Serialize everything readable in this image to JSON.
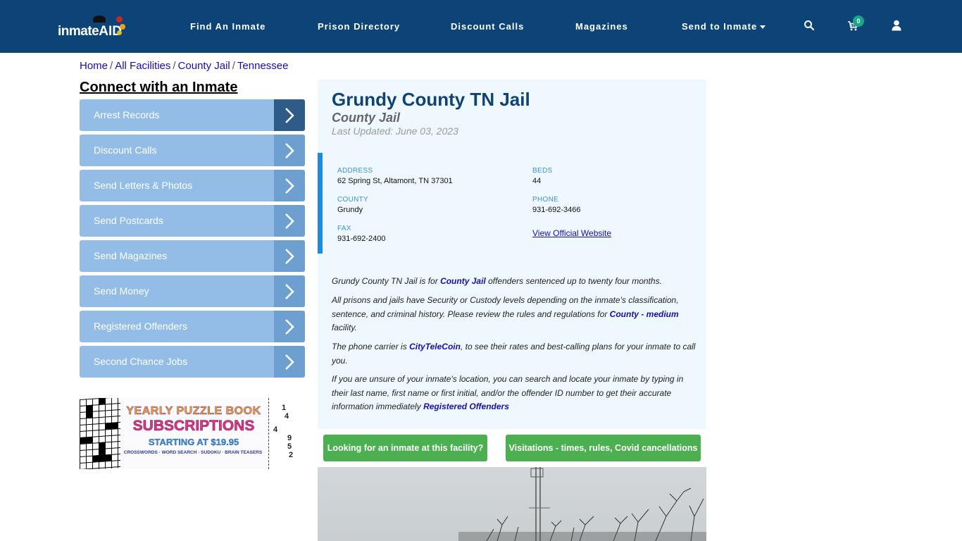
{
  "brand": {
    "logo_text_main": "inmate",
    "logo_text_accent": "AID"
  },
  "nav": {
    "links": [
      {
        "label": "Find An Inmate"
      },
      {
        "label": "Prison Directory"
      },
      {
        "label": "Discount Calls"
      },
      {
        "label": "Magazines"
      },
      {
        "label": "Send to Inmate"
      }
    ],
    "cart_count": "0",
    "icons": [
      "search-icon",
      "cart-icon",
      "user-icon"
    ]
  },
  "breadcrumb": [
    {
      "label": "Home"
    },
    {
      "label": "All Facilities"
    },
    {
      "label": "County Jail"
    },
    {
      "label": "Tennessee"
    }
  ],
  "breadcrumb_separator": "/",
  "sidebar": {
    "title": "Connect with an Inmate",
    "items": [
      {
        "label": "Arrest Records"
      },
      {
        "label": "Discount Calls"
      },
      {
        "label": "Send Letters & Photos"
      },
      {
        "label": "Send Postcards"
      },
      {
        "label": "Send Magazines"
      },
      {
        "label": "Send Money"
      },
      {
        "label": "Registered Offenders"
      },
      {
        "label": "Second Chance Jobs"
      }
    ],
    "ad": {
      "line1": "YEARLY PUZZLE BOOK",
      "line2": "SUBSCRIPTIONS",
      "line3": "STARTING AT $19.95",
      "line4": "CROSSWORDS · WORD SEARCH · SUDOKU · BRAIN TEASERS",
      "sudoku_numbers": [
        "1",
        "4",
        "4",
        "9",
        "5",
        "2"
      ]
    }
  },
  "facility": {
    "title": "Grundy County TN Jail",
    "type": "County Jail",
    "last_updated": "Last Updated: June 03, 2023",
    "fields": {
      "address_label": "ADDRESS",
      "address": "62 Spring St, Altamont, TN 37301",
      "beds_label": "BEDS",
      "beds": "44",
      "county_label": "COUNTY",
      "county": "Grundy",
      "phone_label": "PHONE",
      "phone": "931-692-3466",
      "fax_label": "FAX",
      "fax": "931-692-2400",
      "website_link": "View Official Website"
    },
    "description": {
      "p1_a": "Grundy County TN Jail is for ",
      "p1_link": "County Jail",
      "p1_b": " offenders sentenced up to twenty four months.",
      "p2_a": "All prisons and jails have Security or Custody levels depending on the inmate's classification, sentence, and criminal history. Please review the rules and regulations for ",
      "p2_link": "County - medium",
      "p2_b": " facility.",
      "p3_a": "The phone carrier is ",
      "p3_link": "CityTeleCoin",
      "p3_b": ", to see their rates and best-calling plans for your inmate to call you.",
      "p4_a": "If you are unsure of your inmate's location, you can search and locate your inmate by typing in their last name, first name or first initial, and/or the offender ID number to get their accurate information immediately ",
      "p4_link": "Registered Offenders"
    }
  },
  "buttons": {
    "find_inmate": "Looking for an inmate at this facility?",
    "visitations": "Visitations - times, rules, Covid cancellations"
  },
  "colors": {
    "navbar": "#0c4477",
    "sidebar_item": "#93bde7",
    "sidebar_arrow": "#6d9fd0",
    "sidebar_arrow_active": "#2f5b88",
    "panel_bg": "#eef8fe",
    "title": "#0f4374",
    "accent_blue": "#1a8ae6",
    "button_green": "#4caf50",
    "badge": "#19a886"
  }
}
